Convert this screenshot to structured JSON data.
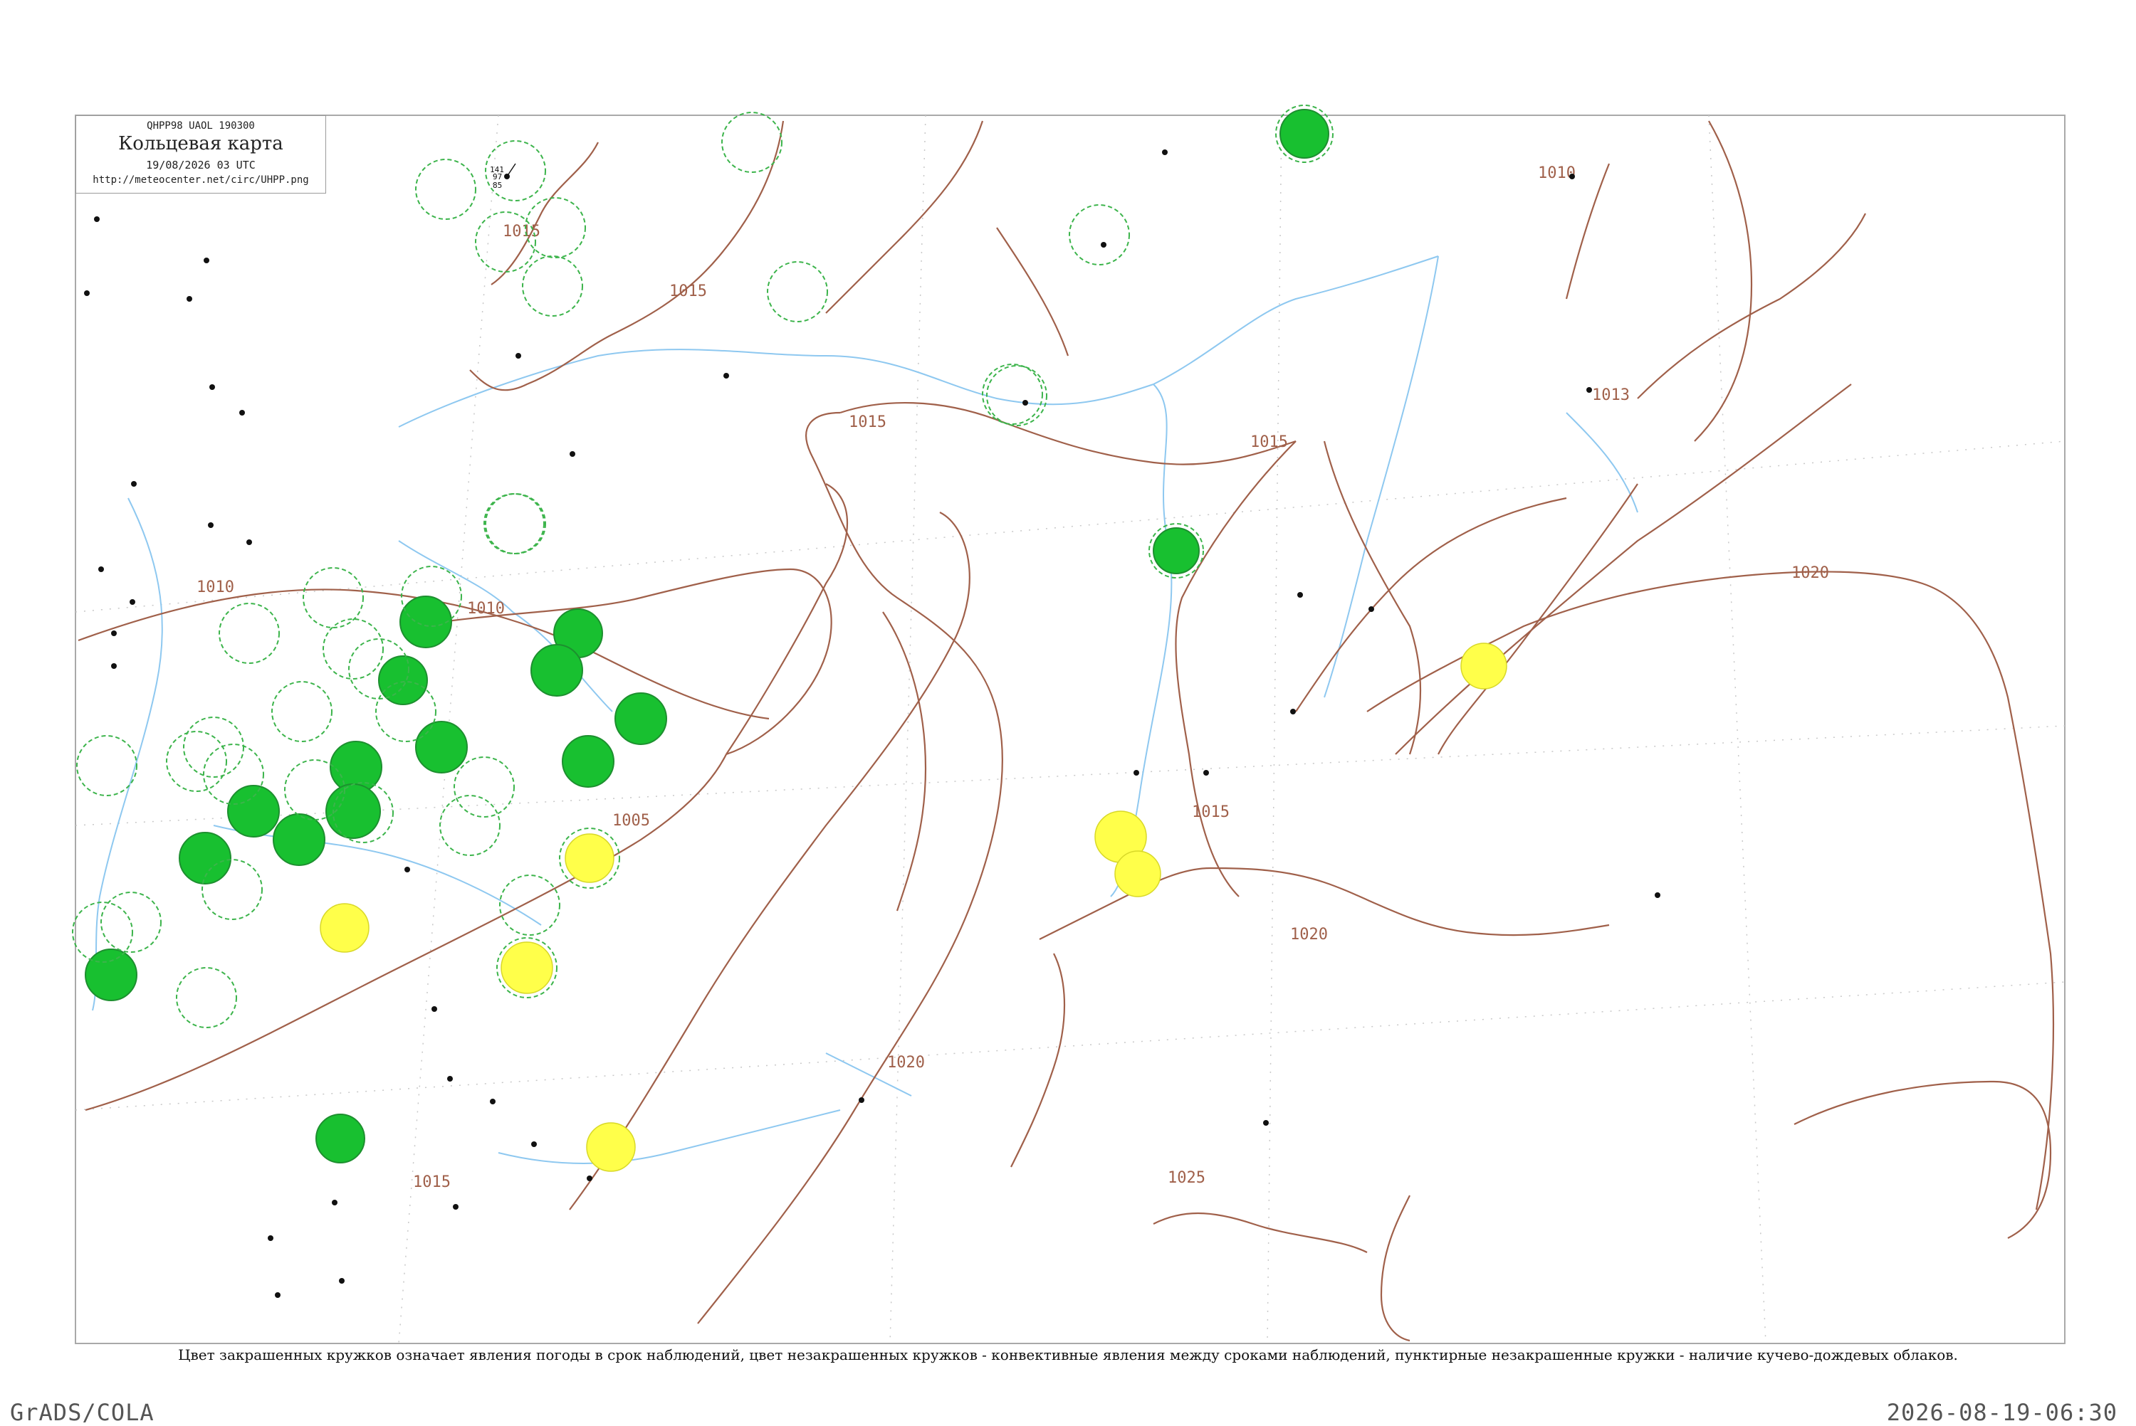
{
  "legend": {
    "code": "QHPP98  UAOL  190300",
    "title": "Кольцевая карта",
    "date": "19/08/2026 03 UTC",
    "url": "http://meteocenter.net/circ/UHPP.png"
  },
  "caption": "Цвет закрашенных кружков означает явления погоды в срок наблюдений, цвет незакрашенных кружков - конвективные явления между сроками наблюдений, пунктирные незакрашенные кружки - наличие кучево-дождевых облаков.",
  "footer": {
    "left": "GrADS/COLA",
    "right": "2026-08-19-06:30"
  },
  "colors": {
    "isobar": "#a0604a",
    "water": "#8ec8f0",
    "station_green": "#18c030",
    "station_yellow": "#ffff4a",
    "dashed_ring": "#3cb44b",
    "frame": "#a9a9a9"
  },
  "isobar_labels": [
    "1015",
    "1015",
    "1015",
    "1010",
    "1010",
    "1005",
    "1010",
    "1020",
    "1015",
    "1020",
    "1020",
    "1025",
    "1010",
    "1013",
    "1015",
    "1015"
  ],
  "stations": [
    {
      "name": "Кольцевая",
      "t": "141",
      "p": "97",
      "d": "85"
    }
  ]
}
